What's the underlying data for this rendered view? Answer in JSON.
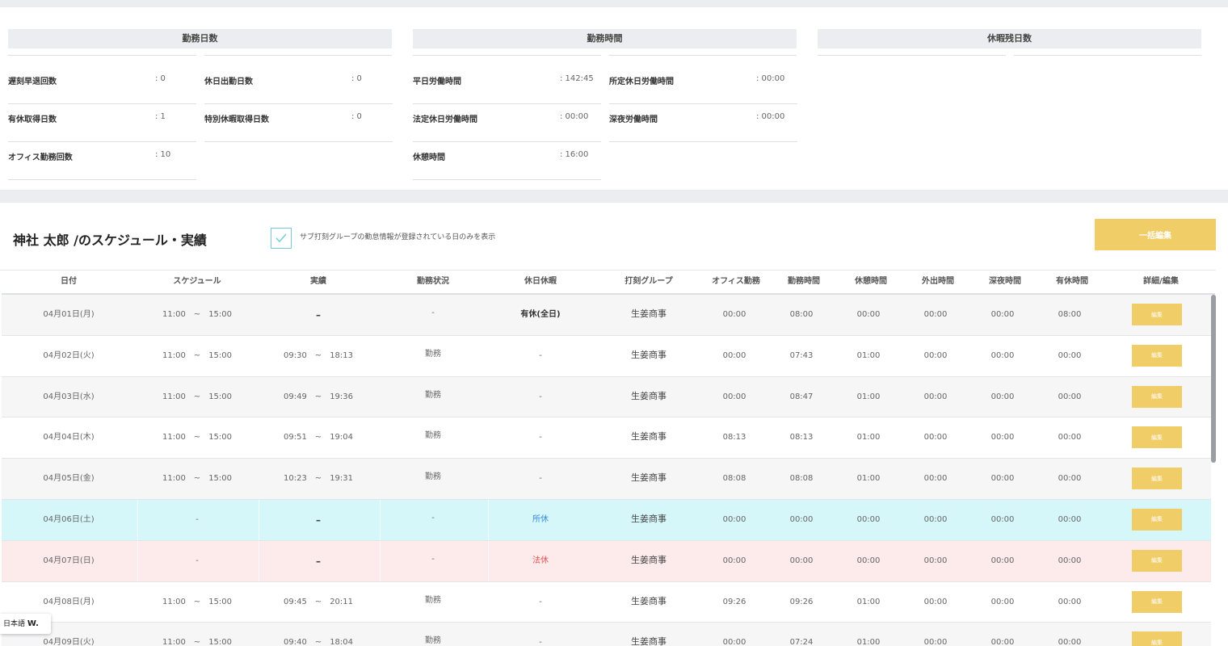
{
  "summary": {
    "work_days": {
      "title": "勤務日数",
      "stats": [
        {
          "label": "遅刻早退回数",
          "value": ": 0"
        },
        {
          "label": "休日出勤日数",
          "value": ": 0"
        },
        {
          "label": "有休取得日数",
          "value": ": 1"
        },
        {
          "label": "特別休暇取得日数",
          "value": ": 0"
        },
        {
          "label": "オフィス勤務回数",
          "value": ": 10"
        }
      ]
    },
    "work_hours": {
      "title": "勤務時間",
      "stats": [
        {
          "label": "平日労働時間",
          "value": ": 142:45"
        },
        {
          "label": "所定休日労働時間",
          "value": ": 00:00"
        },
        {
          "label": "法定休日労働時間",
          "value": ": 00:00"
        },
        {
          "label": "深夜労働時間",
          "value": ": 00:00"
        },
        {
          "label": "休憩時間",
          "value": ": 16:00"
        }
      ]
    },
    "leave_balance": {
      "title": "休暇残日数"
    }
  },
  "schedule": {
    "title": "神社 太郎 /のスケジュール・実績",
    "filter_checked": true,
    "filter_label": "サブ打刻グループの勤怠情報が登録されている日のみを表示",
    "bulk_edit_label": "一括編集",
    "columns": [
      "日付",
      "スケジュール",
      "実績",
      "勤務状況",
      "休日休暇",
      "打刻グループ",
      "オフィス勤務",
      "勤務時間",
      "休憩時間",
      "外出時間",
      "深夜時間",
      "有休時間",
      "詳細/編集"
    ],
    "edit_label": "編集",
    "rows": [
      {
        "date": "04月01日(月)",
        "schedule": "11:00　~　15:00",
        "actual": "–",
        "status": "-",
        "holiday": "有休(全日)",
        "group": "生姜商事",
        "office": "00:00",
        "work": "08:00",
        "break": "00:00",
        "out": "00:00",
        "night": "00:00",
        "paid": "08:00",
        "tone": "gray"
      },
      {
        "date": "04月02日(火)",
        "schedule": "11:00　~　15:00",
        "actual": "09:30　~　18:13",
        "status": "勤務",
        "holiday": "-",
        "group": "生姜商事",
        "office": "00:00",
        "work": "07:43",
        "break": "01:00",
        "out": "00:00",
        "night": "00:00",
        "paid": "00:00",
        "tone": "white"
      },
      {
        "date": "04月03日(水)",
        "schedule": "11:00　~　15:00",
        "actual": "09:49　~　19:36",
        "status": "勤務",
        "holiday": "-",
        "group": "生姜商事",
        "office": "00:00",
        "work": "08:47",
        "break": "01:00",
        "out": "00:00",
        "night": "00:00",
        "paid": "00:00",
        "tone": "gray"
      },
      {
        "date": "04月04日(木)",
        "schedule": "11:00　~　15:00",
        "actual": "09:51　~　19:04",
        "status": "勤務",
        "holiday": "-",
        "group": "生姜商事",
        "office": "08:13",
        "work": "08:13",
        "break": "01:00",
        "out": "00:00",
        "night": "00:00",
        "paid": "00:00",
        "tone": "white"
      },
      {
        "date": "04月05日(金)",
        "schedule": "11:00　~　15:00",
        "actual": "10:23　~　19:31",
        "status": "勤務",
        "holiday": "-",
        "group": "生姜商事",
        "office": "08:08",
        "work": "08:08",
        "break": "01:00",
        "out": "00:00",
        "night": "00:00",
        "paid": "00:00",
        "tone": "gray"
      },
      {
        "date": "04月06日(土)",
        "schedule": "-",
        "actual": "–",
        "status": "-",
        "holiday": "所休",
        "group": "生姜商事",
        "office": "00:00",
        "work": "00:00",
        "break": "00:00",
        "out": "00:00",
        "night": "00:00",
        "paid": "00:00",
        "tone": "cyan"
      },
      {
        "date": "04月07日(日)",
        "schedule": "-",
        "actual": "–",
        "status": "-",
        "holiday": "法休",
        "group": "生姜商事",
        "office": "00:00",
        "work": "00:00",
        "break": "00:00",
        "out": "00:00",
        "night": "00:00",
        "paid": "00:00",
        "tone": "pink"
      },
      {
        "date": "04月08日(月)",
        "schedule": "11:00　~　15:00",
        "actual": "09:45　~　20:11",
        "status": "勤務",
        "holiday": "-",
        "group": "生姜商事",
        "office": "09:26",
        "work": "09:26",
        "break": "01:00",
        "out": "00:00",
        "night": "00:00",
        "paid": "00:00",
        "tone": "white"
      },
      {
        "date": "04月09日(火)",
        "schedule": "11:00　~　15:00",
        "actual": "09:40　~　18:04",
        "status": "勤務",
        "holiday": "-",
        "group": "生姜商事",
        "office": "00:00",
        "work": "07:24",
        "break": "01:00",
        "out": "00:00",
        "night": "00:00",
        "paid": "00:00",
        "tone": "gray"
      }
    ]
  },
  "language_widget": {
    "label": "日本語",
    "logo": "W."
  },
  "colors": {
    "accent": "#f1cd67",
    "check": "#74cdd8",
    "saturday": "#d6f7fa",
    "sunday": "#fdeaea"
  }
}
